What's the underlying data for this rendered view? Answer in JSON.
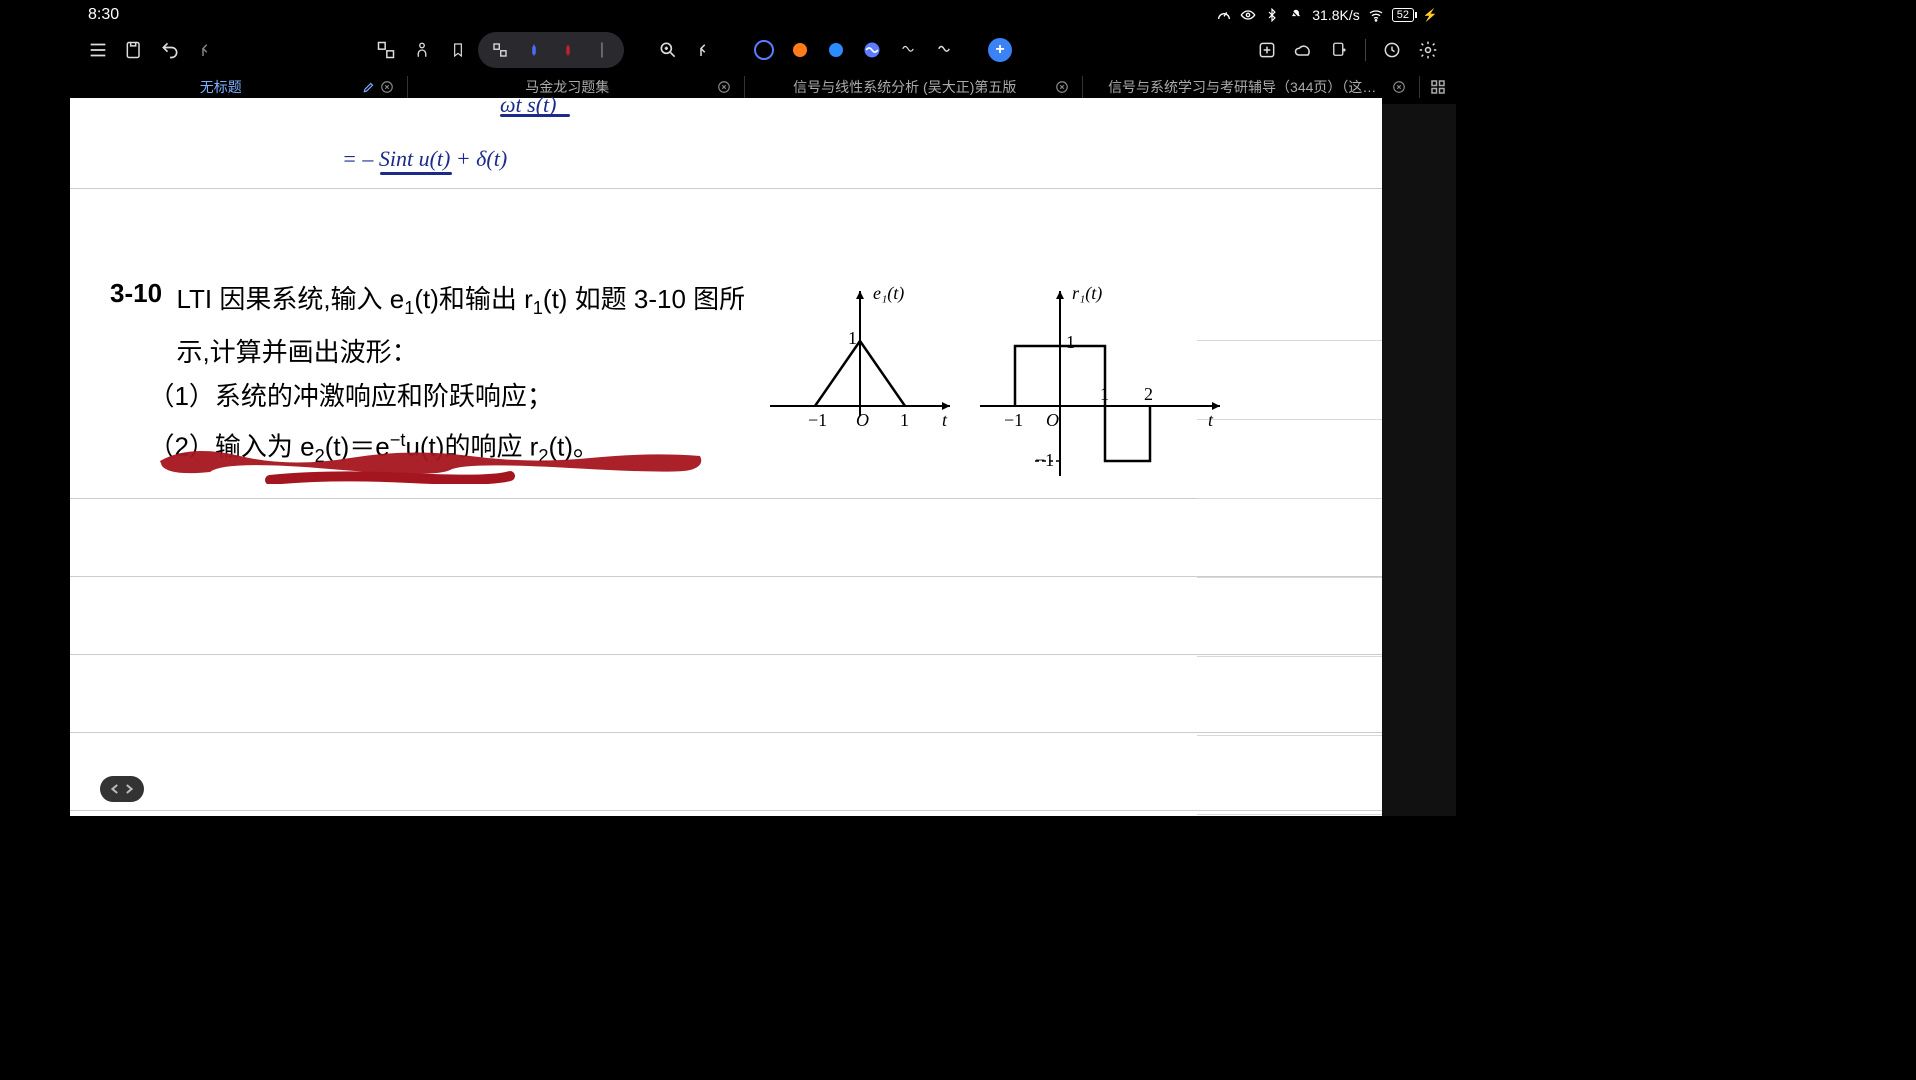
{
  "statusbar": {
    "time": "8:30",
    "net_speed": "31.8K/s",
    "battery_text": "52"
  },
  "toolbar": {
    "dot_colors": [
      "#ff7a18",
      "#2a8cff"
    ]
  },
  "tabs": [
    {
      "label": "无标题",
      "active": true,
      "pencil": true,
      "close": true
    },
    {
      "label": "马金龙习题集",
      "active": false,
      "pencil": false,
      "close": true
    },
    {
      "label": "信号与线性系统分析 (吴大正)第五版",
      "active": false,
      "pencil": false,
      "close": true
    },
    {
      "label": "信号与系统学习与考研辅导（344页）（这…",
      "active": false,
      "pencil": false,
      "close": true
    }
  ],
  "handwriting": {
    "line_top": "ωt s(t)",
    "line_main": "= – Sint u(t) + δ(t)"
  },
  "problem": {
    "number": "3-10",
    "line1_a": "LTI 因果系统,输入 e",
    "line1_b": "(t)和输出 r",
    "line1_c": "(t) 如题 3-10 图所",
    "line2": "示,计算并画出波形：",
    "item1": "（1）系统的冲激响应和阶跃响应；",
    "item2_a": "（2）输入为 e",
    "item2_b": "(t)＝e",
    "item2_c": "u(t)的响应 r",
    "item2_d": "(t)。",
    "sub1": "1",
    "sub2": "2",
    "exp": "−t"
  },
  "figure_labels": {
    "e1": "e₁(t)",
    "r1": "r₁(t)",
    "one": "1",
    "neg_one": "−1",
    "two": "2",
    "O": "O",
    "t": "t"
  },
  "chart_data": [
    {
      "type": "line",
      "title": "e₁(t)",
      "xlabel": "t",
      "ylabel": "",
      "x": [
        -1,
        0,
        1
      ],
      "values": [
        0,
        1,
        0
      ],
      "xlim": [
        -1.3,
        1.6
      ],
      "ylim": [
        0,
        1.2
      ]
    },
    {
      "type": "line",
      "title": "r₁(t)",
      "xlabel": "t",
      "ylabel": "",
      "x": [
        -1,
        -1,
        1,
        1,
        2,
        2
      ],
      "values": [
        0,
        1,
        1,
        -1,
        -1,
        0
      ],
      "xlim": [
        -1.3,
        2.5
      ],
      "ylim": [
        -1.2,
        1.2
      ]
    }
  ]
}
